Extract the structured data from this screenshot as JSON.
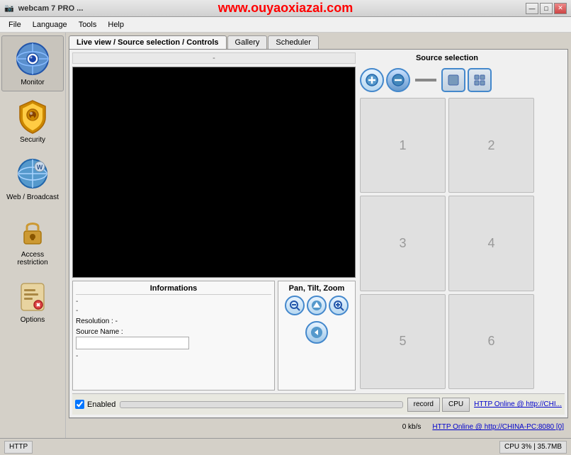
{
  "titleBar": {
    "title": "webcam 7 PRO ...",
    "watermark": "www.ouyaoxiazai.com",
    "buttons": {
      "minimize": "—",
      "maximize": "□",
      "close": "✕"
    }
  },
  "menuBar": {
    "items": [
      "File",
      "Language",
      "Tools",
      "Help"
    ]
  },
  "tabs": {
    "main": "Live view / Source selection / Controls",
    "gallery": "Gallery",
    "scheduler": "Scheduler"
  },
  "sourceSelection": {
    "title": "Source selection",
    "cells": [
      "1",
      "2",
      "3",
      "4",
      "5",
      "6"
    ]
  },
  "videoPreview": {
    "title": "-"
  },
  "infoPanel": {
    "title": "Informations",
    "line1": "-",
    "line2": "-",
    "resolutionLabel": "Resolution :",
    "resolutionValue": "-",
    "sourceNameLabel": "Source Name :",
    "sourceNameValue": "",
    "line3": "-"
  },
  "ptzPanel": {
    "title": "Pan, Tilt, Zoom"
  },
  "sidebar": {
    "items": [
      {
        "label": "Monitor"
      },
      {
        "label": "Security"
      },
      {
        "label": "Web / Broadcast"
      },
      {
        "label": "Access restriction"
      },
      {
        "label": "Options"
      }
    ]
  },
  "bottomBar": {
    "speed": "0 kb/s",
    "link": "HTTP Online @ http://CHINA-PC:8080 [0]"
  },
  "statusBar": {
    "http": "HTTP",
    "cpu": "CPU 3% | 35.7MB"
  },
  "controls": {
    "enabledLabel": "Enabled",
    "recordLabel": "record",
    "cpuLabel": "CPU"
  }
}
